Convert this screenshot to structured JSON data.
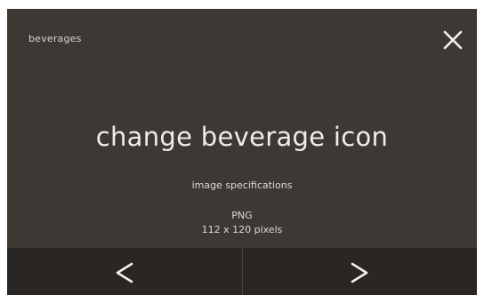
{
  "header": {
    "title": "beverages",
    "close_icon": "close-icon"
  },
  "main": {
    "heading": "change beverage icon",
    "spec_label": "image specifications",
    "spec_format": "PNG",
    "spec_size": "112 x 120 pixels"
  },
  "footer": {
    "prev_icon": "chevron-left-icon",
    "next_icon": "chevron-right-icon"
  },
  "colors": {
    "background": "#3e3834",
    "footer": "#2a2624",
    "text": "#efedea"
  }
}
